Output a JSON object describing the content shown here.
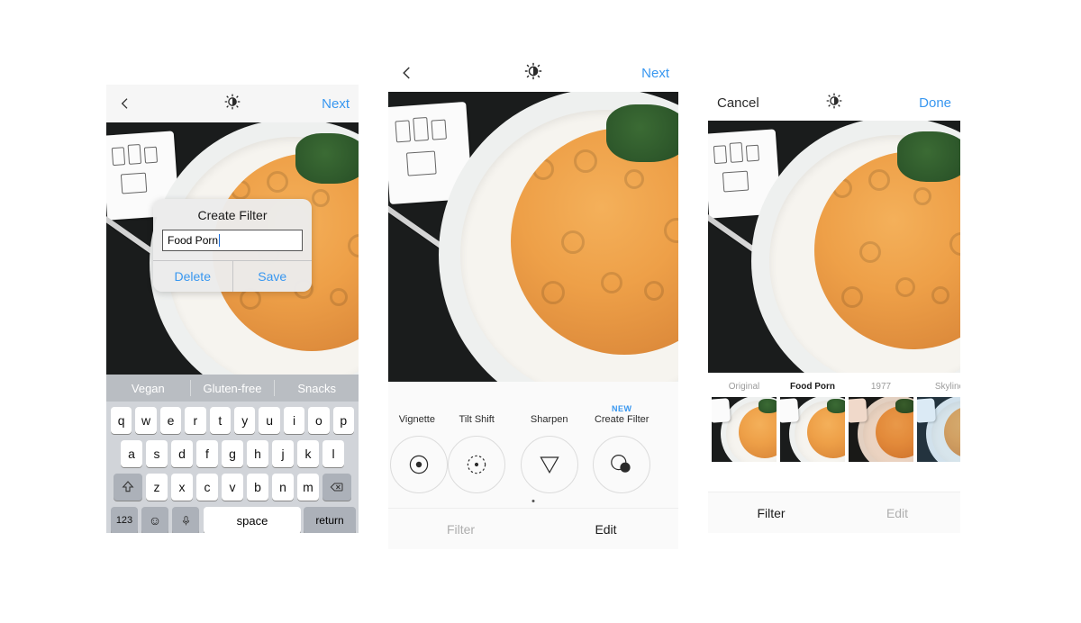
{
  "colors": {
    "accent": "#3897f0"
  },
  "icons": {
    "sun": "brightness-icon",
    "back": "back-icon"
  },
  "phone1": {
    "nav": {
      "next": "Next"
    },
    "modal": {
      "title": "Create Filter",
      "value": "Food Porn",
      "delete": "Delete",
      "save": "Save"
    },
    "predictions": [
      "Vegan",
      "Gluten-free",
      "Snacks"
    ],
    "keyboard": {
      "rows": [
        [
          "q",
          "w",
          "e",
          "r",
          "t",
          "y",
          "u",
          "i",
          "o",
          "p"
        ],
        [
          "a",
          "s",
          "d",
          "f",
          "g",
          "h",
          "j",
          "k",
          "l"
        ],
        [
          "z",
          "x",
          "c",
          "v",
          "b",
          "n",
          "m"
        ]
      ],
      "numKey": "123",
      "space": "space",
      "return": "return"
    }
  },
  "phone2": {
    "nav": {
      "next": "Next"
    },
    "tools": [
      {
        "label_top": "",
        "label": "Vignette",
        "icon": "vignette",
        "partial": true
      },
      {
        "label_top": "",
        "label": "Tilt Shift",
        "icon": "tilt-shift"
      },
      {
        "label_top": "",
        "label": "Sharpen",
        "icon": "sharpen"
      },
      {
        "label_top": "NEW",
        "label": "Create Filter",
        "icon": "create-filter"
      }
    ],
    "tabs": {
      "filter": "Filter",
      "edit": "Edit",
      "active": "edit"
    }
  },
  "phone3": {
    "nav": {
      "cancel": "Cancel",
      "done": "Done"
    },
    "filters": [
      {
        "label": "Original",
        "tint": ""
      },
      {
        "label": "Food Porn",
        "tint": "",
        "selected": true
      },
      {
        "label": "1977",
        "tint": "t1977"
      },
      {
        "label": "Skyline",
        "tint": "tsky",
        "partial": true
      }
    ],
    "tabs": {
      "filter": "Filter",
      "edit": "Edit",
      "active": "filter"
    }
  }
}
